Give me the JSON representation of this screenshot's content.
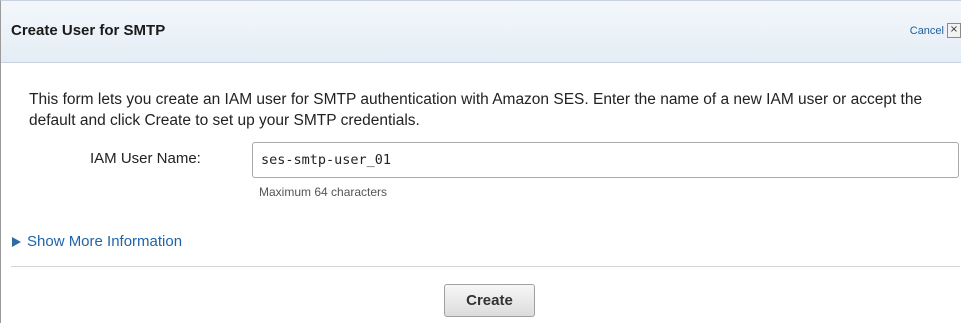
{
  "dialog": {
    "title": "Create User for SMTP",
    "cancel_label": "Cancel",
    "close_glyph": "×",
    "intro_text": "This form lets you create an IAM user for SMTP authentication with Amazon SES. Enter the name of a new IAM user or accept the default and click Create to set up your SMTP credentials.",
    "field": {
      "label": "IAM User Name:",
      "value": "ses-smtp-user_01",
      "hint": "Maximum 64 characters"
    },
    "more_info_label": "Show More Information",
    "create_label": "Create"
  },
  "colors": {
    "link": "#1f64a8",
    "header_bg": "#e4edf5"
  },
  "icons": {
    "close": "close-icon",
    "expand": "triangle-right-icon"
  }
}
